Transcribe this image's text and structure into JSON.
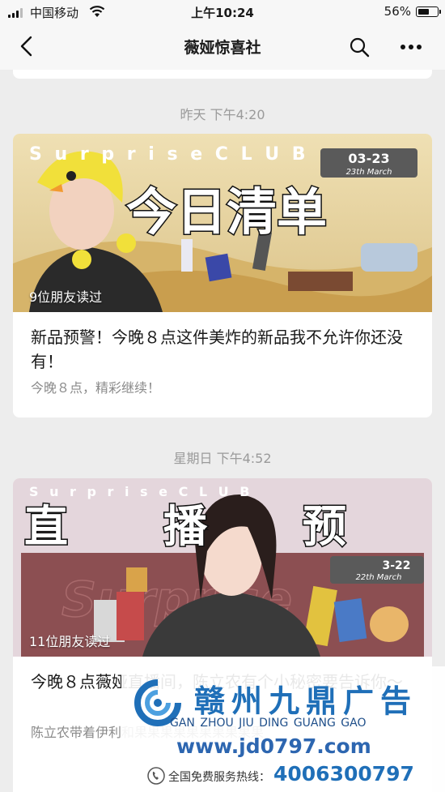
{
  "status_bar": {
    "carrier": "中国移动",
    "time": "上午10:24",
    "battery": "56%"
  },
  "nav": {
    "title": "薇娅惊喜社",
    "back_icon": "chevron-left-icon",
    "search_icon": "search-icon",
    "more_icon": "more-horizontal-icon"
  },
  "messages": [
    {
      "timestamp": "昨天 下午4:20",
      "banner": {
        "top_text": "S u r p r i s e   C L U B",
        "date": "03-23",
        "date_en": "23th March",
        "title": "今日清单"
      },
      "read_count": "9位朋友读过",
      "headline": "新品预警！今晚８点这件美炸的新品我不允许你还没有！",
      "digest": "今晚８点，精彩继续！"
    },
    {
      "timestamp": "星期日 下午4:52",
      "banner": {
        "top_text": "S u r p r i s e   C L U B",
        "date": "3-22",
        "date_en": "22th March",
        "title": "直播预告",
        "watermark": "Surprise"
      },
      "read_count": "11位朋友读过",
      "headline": "今晚８点薇娅直播间，陈立农有个小秘密要告诉你～",
      "digest": "陈立农带着伊利和果果果果果果果果果果"
    }
  ],
  "watermark": {
    "name_cn": "赣州九鼎广告",
    "pinyin": "GAN  ZHOU  JIU  DING  GUANG  GAO",
    "url": "www.jd0797.com",
    "hotline_label": "全国免费服务热线：",
    "phone": "4006300797"
  },
  "colors": {
    "background": "#ededed",
    "card": "#ffffff",
    "timestamp": "#9a9a9a",
    "banner1": "#e9d6a6",
    "banner2": "#c9a9b8",
    "watermark_blue": "#1f6fb8"
  }
}
